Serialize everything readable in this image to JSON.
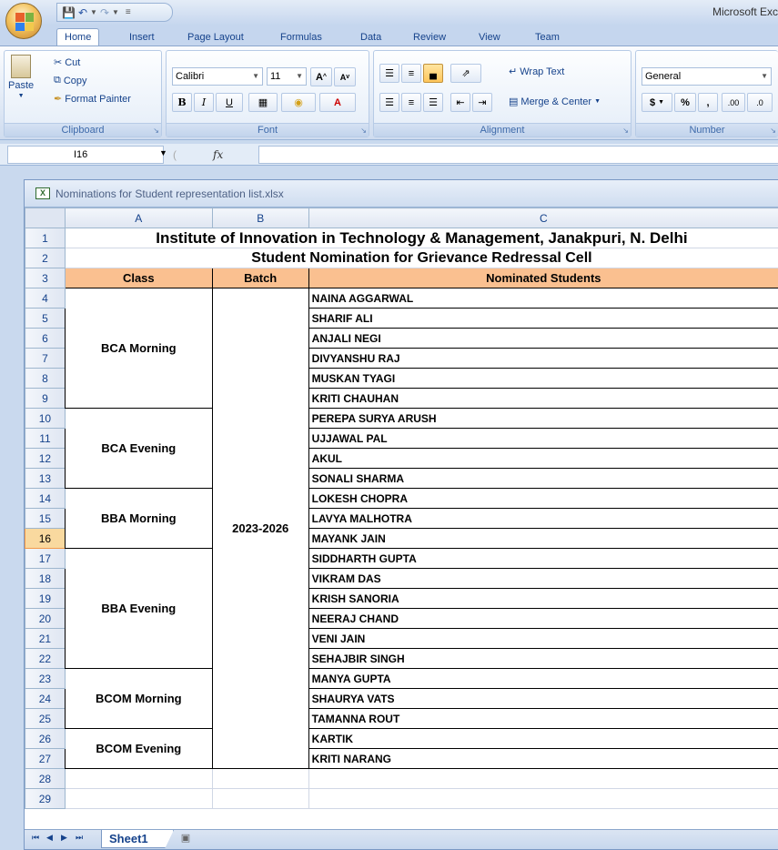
{
  "app": {
    "title": "Microsoft Exc"
  },
  "colors": {
    "header_fill": "#fac090",
    "selected_row": "#f9d99f"
  },
  "qat": {
    "save_icon": "save-icon",
    "undo_icon": "undo-icon",
    "redo_icon": "redo-icon"
  },
  "tabs": [
    "Home",
    "Insert",
    "Page Layout",
    "Formulas",
    "Data",
    "Review",
    "View",
    "Team"
  ],
  "ribbon": {
    "clipboard": {
      "paste": "Paste",
      "cut": "Cut",
      "copy": "Copy",
      "format_painter": "Format Painter",
      "label": "Clipboard"
    },
    "font": {
      "name": "Calibri",
      "size": "11",
      "bold": "B",
      "italic": "I",
      "underline": "U",
      "label": "Font"
    },
    "alignment": {
      "wrap_text": "Wrap Text",
      "merge_center": "Merge & Center",
      "label": "Alignment"
    },
    "number": {
      "format": "General",
      "currency": "$",
      "percent": "%",
      "comma": ",",
      "inc_decimal": ".00",
      "dec_decimal": ".0",
      "label": "Number"
    }
  },
  "formula_bar": {
    "name_box": "I16",
    "fx": "fx"
  },
  "workbook": {
    "title": "Nominations for Student representation list.xlsx",
    "columns": [
      "A",
      "B",
      "C"
    ],
    "rows": [
      "1",
      "2",
      "3",
      "4",
      "5",
      "6",
      "7",
      "8",
      "9",
      "10",
      "11",
      "12",
      "13",
      "14",
      "15",
      "16",
      "17",
      "18",
      "19",
      "20",
      "21",
      "22",
      "23",
      "24",
      "25",
      "26",
      "27",
      "28",
      "29"
    ],
    "title1": "Institute of Innovation in Technology & Management, Janakpuri, N. Delhi",
    "title2": "Student Nomination for Grievance Redressal Cell",
    "headers": {
      "class": "Class",
      "batch": "Batch",
      "students": "Nominated Students"
    },
    "batch": "2023-2026",
    "classes": [
      {
        "name": "BCA Morning",
        "students": [
          "NAINA AGGARWAL",
          "SHARIF ALI",
          "ANJALI NEGI",
          "DIVYANSHU RAJ",
          "MUSKAN TYAGI",
          "KRITI CHAUHAN"
        ]
      },
      {
        "name": "BCA Evening",
        "students": [
          "PEREPA SURYA ARUSH",
          "UJJAWAL PAL",
          "AKUL",
          "SONALI SHARMA"
        ]
      },
      {
        "name": "BBA Morning",
        "students": [
          "LOKESH CHOPRA",
          "LAVYA MALHOTRA",
          "MAYANK JAIN"
        ]
      },
      {
        "name": "BBA Evening",
        "students": [
          "SIDDHARTH GUPTA",
          "VIKRAM DAS",
          "KRISH SANORIA",
          "NEERAJ CHAND",
          "VENI JAIN",
          "SEHAJBIR SINGH"
        ]
      },
      {
        "name": "BCOM Morning",
        "students": [
          "MANYA GUPTA",
          "SHAURYA VATS",
          "TAMANNA ROUT"
        ]
      },
      {
        "name": "BCOM Evening",
        "students": [
          "KARTIK",
          "KRITI NARANG"
        ]
      }
    ],
    "selected_row": "16",
    "sheet_tab": "Sheet1"
  }
}
